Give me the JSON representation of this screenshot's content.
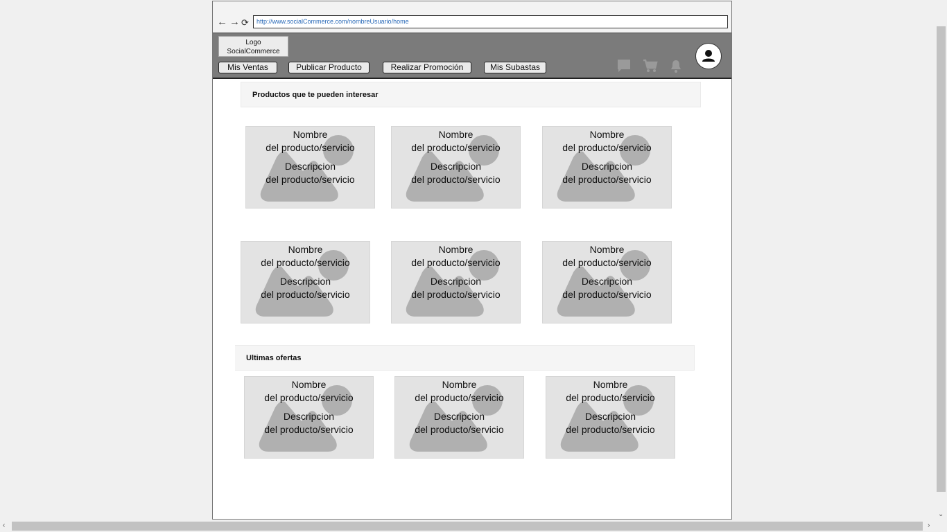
{
  "browser": {
    "url": "http://www.socialCommerce.com/nombreUsuario/home",
    "back": "←",
    "forward": "→",
    "reload": "⟳"
  },
  "header": {
    "logo_line1": "Logo",
    "logo_line2": "SocialCommerce",
    "tabs": [
      {
        "label": "Mis Ventas"
      },
      {
        "label": "Publicar Producto"
      },
      {
        "label": "Realizar Promoción"
      },
      {
        "label": "Mis Subastas"
      }
    ],
    "icons": [
      "chat-icon",
      "cart-icon",
      "bell-icon",
      "user-avatar-icon"
    ]
  },
  "sections": {
    "recommended_title": "Productos que te pueden interesar",
    "offers_title": "Ultimas ofertas"
  },
  "card": {
    "name_line1": "Nombre",
    "name_line2": "del producto/servicio",
    "desc_line1": "Descripcion",
    "desc_line2": "del producto/servicio"
  },
  "recommended_cards": [
    {
      "name_line1": "Nombre",
      "name_line2": "del producto/servicio",
      "desc_line1": "Descripcion",
      "desc_line2": "del producto/servicio"
    },
    {
      "name_line1": "Nombre",
      "name_line2": "del producto/servicio",
      "desc_line1": "Descripcion",
      "desc_line2": "del producto/servicio"
    },
    {
      "name_line1": "Nombre",
      "name_line2": "del producto/servicio",
      "desc_line1": "Descripcion",
      "desc_line2": "del producto/servicio"
    },
    {
      "name_line1": "Nombre",
      "name_line2": "del producto/servicio",
      "desc_line1": "Descripcion",
      "desc_line2": "del producto/servicio"
    },
    {
      "name_line1": "Nombre",
      "name_line2": "del producto/servicio",
      "desc_line1": "Descripcion",
      "desc_line2": "del producto/servicio"
    },
    {
      "name_line1": "Nombre",
      "name_line2": "del producto/servicio",
      "desc_line1": "Descripcion",
      "desc_line2": "del producto/servicio"
    }
  ],
  "offer_cards": [
    {
      "name_line1": "Nombre",
      "name_line2": "del producto/servicio",
      "desc_line1": "Descripcion",
      "desc_line2": "del producto/servicio"
    },
    {
      "name_line1": "Nombre",
      "name_line2": "del producto/servicio",
      "desc_line1": "Descripcion",
      "desc_line2": "del producto/servicio"
    },
    {
      "name_line1": "Nombre",
      "name_line2": "del producto/servicio",
      "desc_line1": "Descripcion",
      "desc_line2": "del producto/servicio"
    }
  ],
  "colors": {
    "header_bg": "#7b7b7b",
    "card_bg": "#e3e3e3",
    "placeholder": "#b0b0b0",
    "url_text": "#2a6ab8"
  }
}
